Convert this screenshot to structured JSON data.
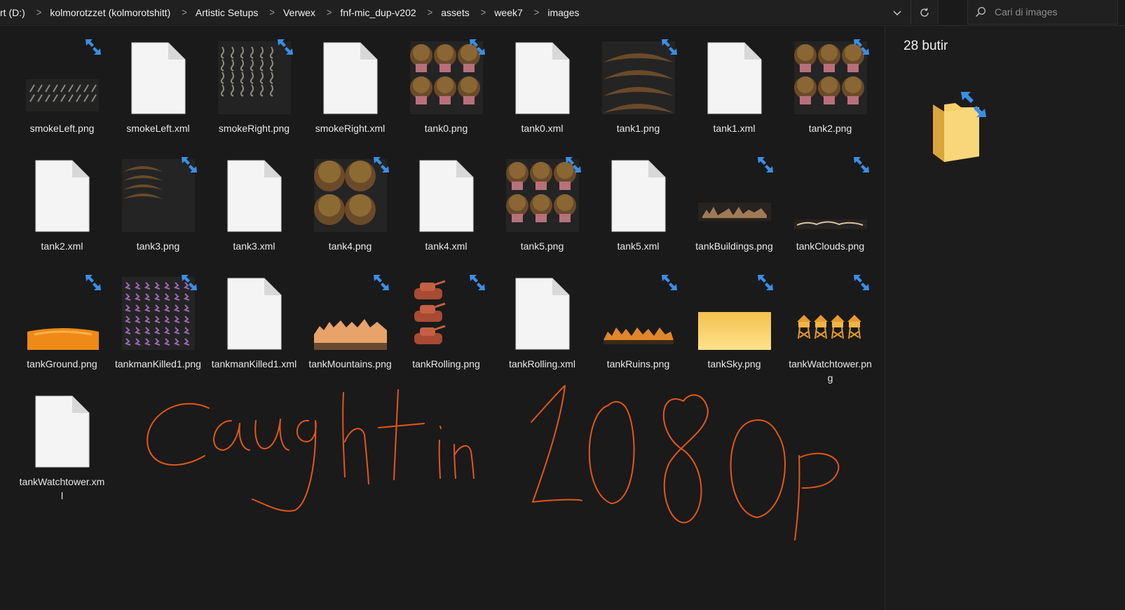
{
  "address_bar": {
    "crumbs": [
      "rt (D:)",
      "kolmorotzzet (kolmorotshitt)",
      "Artistic Setups",
      "Verwex",
      "fnf-mic_dup-v202",
      "assets",
      "week7",
      "images"
    ],
    "dropdown_icon": "chevron-down-icon",
    "refresh_icon": "refresh-icon"
  },
  "search": {
    "placeholder": "Cari di images",
    "icon": "search-icon"
  },
  "details_panel": {
    "item_count": "28 butir",
    "icon": "folder-sync-icon"
  },
  "files": [
    {
      "name": "smokeLeft.png",
      "kind": "png",
      "preview": "smoke-left"
    },
    {
      "name": "smokeLeft.xml",
      "kind": "xml"
    },
    {
      "name": "smokeRight.png",
      "kind": "png",
      "preview": "smoke-right"
    },
    {
      "name": "smokeRight.xml",
      "kind": "xml"
    },
    {
      "name": "tank0.png",
      "kind": "png",
      "preview": "tankmen-grid"
    },
    {
      "name": "tank0.xml",
      "kind": "xml"
    },
    {
      "name": "tank1.png",
      "kind": "png",
      "preview": "hair-arcs"
    },
    {
      "name": "tank1.xml",
      "kind": "xml"
    },
    {
      "name": "tank2.png",
      "kind": "png",
      "preview": "tankmen-grid"
    },
    {
      "name": "tank2.xml",
      "kind": "xml"
    },
    {
      "name": "tank3.png",
      "kind": "png",
      "preview": "hair-arcs-small"
    },
    {
      "name": "tank3.xml",
      "kind": "xml"
    },
    {
      "name": "tank4.png",
      "kind": "png",
      "preview": "heads-grid"
    },
    {
      "name": "tank4.xml",
      "kind": "xml"
    },
    {
      "name": "tank5.png",
      "kind": "png",
      "preview": "tankmen-grid"
    },
    {
      "name": "tank5.xml",
      "kind": "xml"
    },
    {
      "name": "tankBuildings.png",
      "kind": "png",
      "preview": "buildings"
    },
    {
      "name": "tankClouds.png",
      "kind": "png",
      "preview": "clouds"
    },
    {
      "name": "tankGround.png",
      "kind": "png",
      "preview": "ground"
    },
    {
      "name": "tankmanKilled1.png",
      "kind": "png",
      "preview": "killed"
    },
    {
      "name": "tankmanKilled1.xml",
      "kind": "xml"
    },
    {
      "name": "tankMountains.png",
      "kind": "png",
      "preview": "mountains"
    },
    {
      "name": "tankRolling.png",
      "kind": "png",
      "preview": "rolling"
    },
    {
      "name": "tankRolling.xml",
      "kind": "xml"
    },
    {
      "name": "tankRuins.png",
      "kind": "png",
      "preview": "ruins"
    },
    {
      "name": "tankSky.png",
      "kind": "png",
      "preview": "sky"
    },
    {
      "name": "tankWatchtower.png",
      "kind": "png",
      "preview": "watchtower"
    },
    {
      "name": "tankWatchtower.xml",
      "kind": "xml"
    }
  ],
  "annotation": {
    "text": "Caught in 1080p",
    "color": "#e0571a"
  },
  "colors": {
    "sync_badge": "#3a8ee6",
    "background": "#191919"
  }
}
